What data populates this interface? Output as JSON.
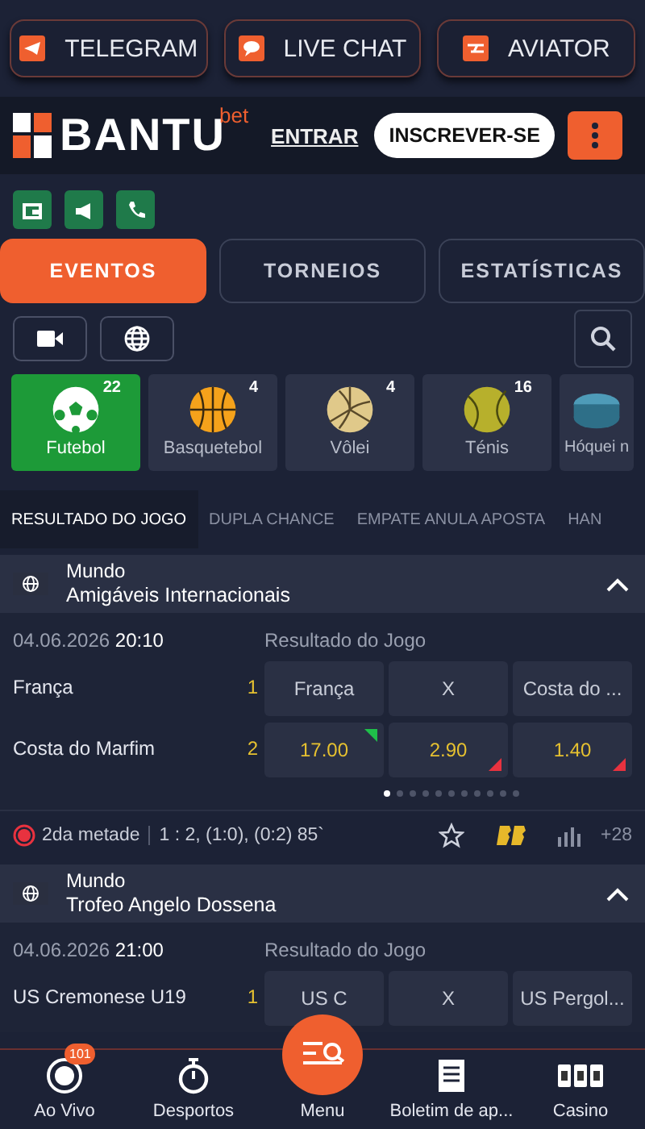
{
  "promo_buttons": [
    {
      "label": "TELEGRAM",
      "kind": "telegram"
    },
    {
      "label": "LIVE CHAT",
      "kind": "chat"
    },
    {
      "label": "AVIATOR",
      "kind": "aviator"
    }
  ],
  "header": {
    "logo": "BANTU",
    "logo_suffix": "bet",
    "login": "ENTRAR",
    "signup": "INSCREVER-SE"
  },
  "tabs": [
    {
      "label": "EVENTOS",
      "selected": true
    },
    {
      "label": "TORNEIOS",
      "selected": false
    },
    {
      "label": "ESTATÍSTICAS",
      "selected": false
    }
  ],
  "sports": [
    {
      "name": "Futebol",
      "count": "22",
      "kind": "football",
      "selected": true
    },
    {
      "name": "Basquetebol",
      "count": "4",
      "kind": "basketball",
      "selected": false
    },
    {
      "name": "Vôlei",
      "count": "4",
      "kind": "volleyball",
      "selected": false
    },
    {
      "name": "Ténis",
      "count": "16",
      "kind": "tennis",
      "selected": false
    },
    {
      "name": "Hóquei n",
      "kind": "hockey",
      "selected": false
    }
  ],
  "market_tabs": [
    {
      "label": "RESULTADO DO JOGO",
      "selected": true
    },
    {
      "label": "DUPLA CHANCE",
      "selected": false
    },
    {
      "label": "EMPATE ANULA APOSTA",
      "selected": false
    },
    {
      "label": "HAN",
      "selected": false
    }
  ],
  "leagues": [
    {
      "region": "Mundo",
      "name": "Amigáveis Internacionais",
      "expanded": true,
      "match": {
        "date": "04.06.2026",
        "time": "20:10",
        "market": "Resultado do Jogo",
        "teams": [
          {
            "name": "França",
            "number": "1"
          },
          {
            "name": "Costa do Marfim",
            "number": "2"
          }
        ],
        "odds_headers": [
          "França",
          "X",
          "Costa do ..."
        ],
        "odds": [
          {
            "value": "17.00",
            "rose": true,
            "fell": false
          },
          {
            "value": "2.90",
            "rose": false,
            "fell": true
          },
          {
            "value": "1.40",
            "rose": false,
            "fell": true
          }
        ],
        "pages": [
          {
            "selected": true
          },
          {
            "selected": false
          },
          {
            "selected": false
          },
          {
            "selected": false
          },
          {
            "selected": false
          },
          {
            "selected": false
          },
          {
            "selected": false
          },
          {
            "selected": false
          },
          {
            "selected": false
          },
          {
            "selected": false
          },
          {
            "selected": false
          }
        ],
        "status": {
          "live": true,
          "period": "2da metade",
          "score": "1 : 2, (1:0), (0:2) 85`",
          "more": "+28"
        }
      }
    },
    {
      "region": "Mundo",
      "name": "Trofeo Angelo Dossena",
      "expanded": true,
      "match": {
        "date": "04.06.2026",
        "time": "21:00",
        "market": "Resultado do Jogo",
        "teams": [
          {
            "name": "US Cremonese U19",
            "number": "1"
          }
        ],
        "odds_headers": [
          "US C",
          "X",
          "US Pergol..."
        ]
      }
    }
  ],
  "bottom_nav": [
    {
      "label": "Ao Vivo",
      "kind": "live",
      "badge": "101"
    },
    {
      "label": "Desportos",
      "kind": "stopwatch"
    },
    {
      "label": "Menu",
      "kind": "menu"
    },
    {
      "label": "Boletim de ap...",
      "kind": "slip"
    },
    {
      "label": "Casino",
      "kind": "casino"
    }
  ]
}
